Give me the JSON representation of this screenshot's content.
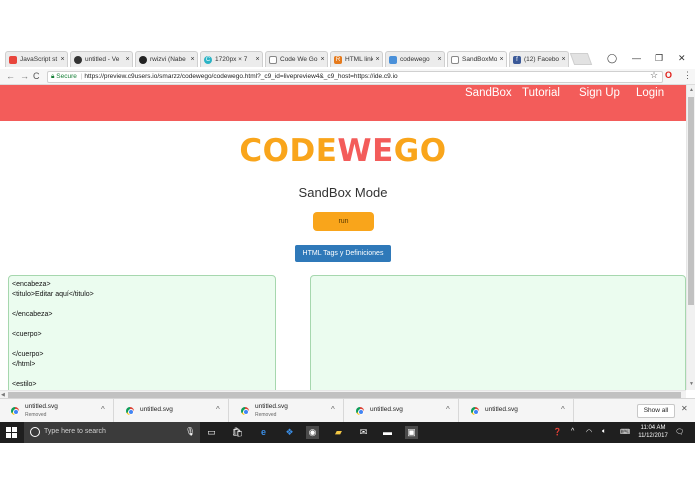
{
  "browser": {
    "tabs": [
      {
        "label": "JavaScript st",
        "icon": "js-icon",
        "color": "#e8453c"
      },
      {
        "label": "untitled - Ve",
        "icon": "vectr-icon",
        "color": "#333333"
      },
      {
        "label": "rwizvi (Nabe",
        "icon": "github-icon",
        "color": "#222222"
      },
      {
        "label": "1720px × 7",
        "icon": "c-icon",
        "color": "#2bb3c5"
      },
      {
        "label": "Code We Go",
        "icon": "page-icon",
        "color": "#888888"
      },
      {
        "label": "HTML link c",
        "icon": "r-icon",
        "color": "#e57a1c"
      },
      {
        "label": "codewego",
        "icon": "cloud9-icon",
        "color": "#4a90d9"
      },
      {
        "label": "SandBoxMo",
        "icon": "page-icon",
        "color": "#888888"
      },
      {
        "label": "(12) Faceboo",
        "icon": "facebook-icon",
        "color": "#3b5998"
      }
    ],
    "secure_label": "Secure",
    "url": "https://preview.c9users.io/smarzz/codewego/codewego.html?_c9_id=livepreview4&_c9_host=https://ide.c9.io"
  },
  "site": {
    "nav": [
      "SandBox",
      "Tutorial",
      "Sign Up",
      "Login"
    ],
    "logo_part1": "CODE",
    "logo_part2": "WE",
    "logo_part3": "GO",
    "mode_title": "SandBox Mode",
    "run_label": "run",
    "tags_label": "HTML Tags y Definiciones",
    "editor_text": "<encabeza>\n<titulo>Editar aquí</titulo>\n\n</encabeza>\n\n<cuerpo>\n\n</cuerpo>\n</html>\n\n<estilo>"
  },
  "downloads": {
    "items": [
      {
        "name": "untitled.svg",
        "status": "Removed"
      },
      {
        "name": "untitled.svg",
        "status": ""
      },
      {
        "name": "untitled.svg",
        "status": "Removed"
      },
      {
        "name": "untitled.svg",
        "status": ""
      },
      {
        "name": "untitled.svg",
        "status": ""
      }
    ],
    "show_all": "Show all"
  },
  "taskbar": {
    "search_placeholder": "Type here to search",
    "time": "11:04 AM",
    "date": "11/12/2017"
  },
  "colors": {
    "navbar": "#f35c5a",
    "logo_orange": "#f9a51b",
    "logo_red": "#f35c5a",
    "run_button": "#f9a51b",
    "tags_button": "#2f79b9",
    "editor_bg": "#ebfcef"
  }
}
